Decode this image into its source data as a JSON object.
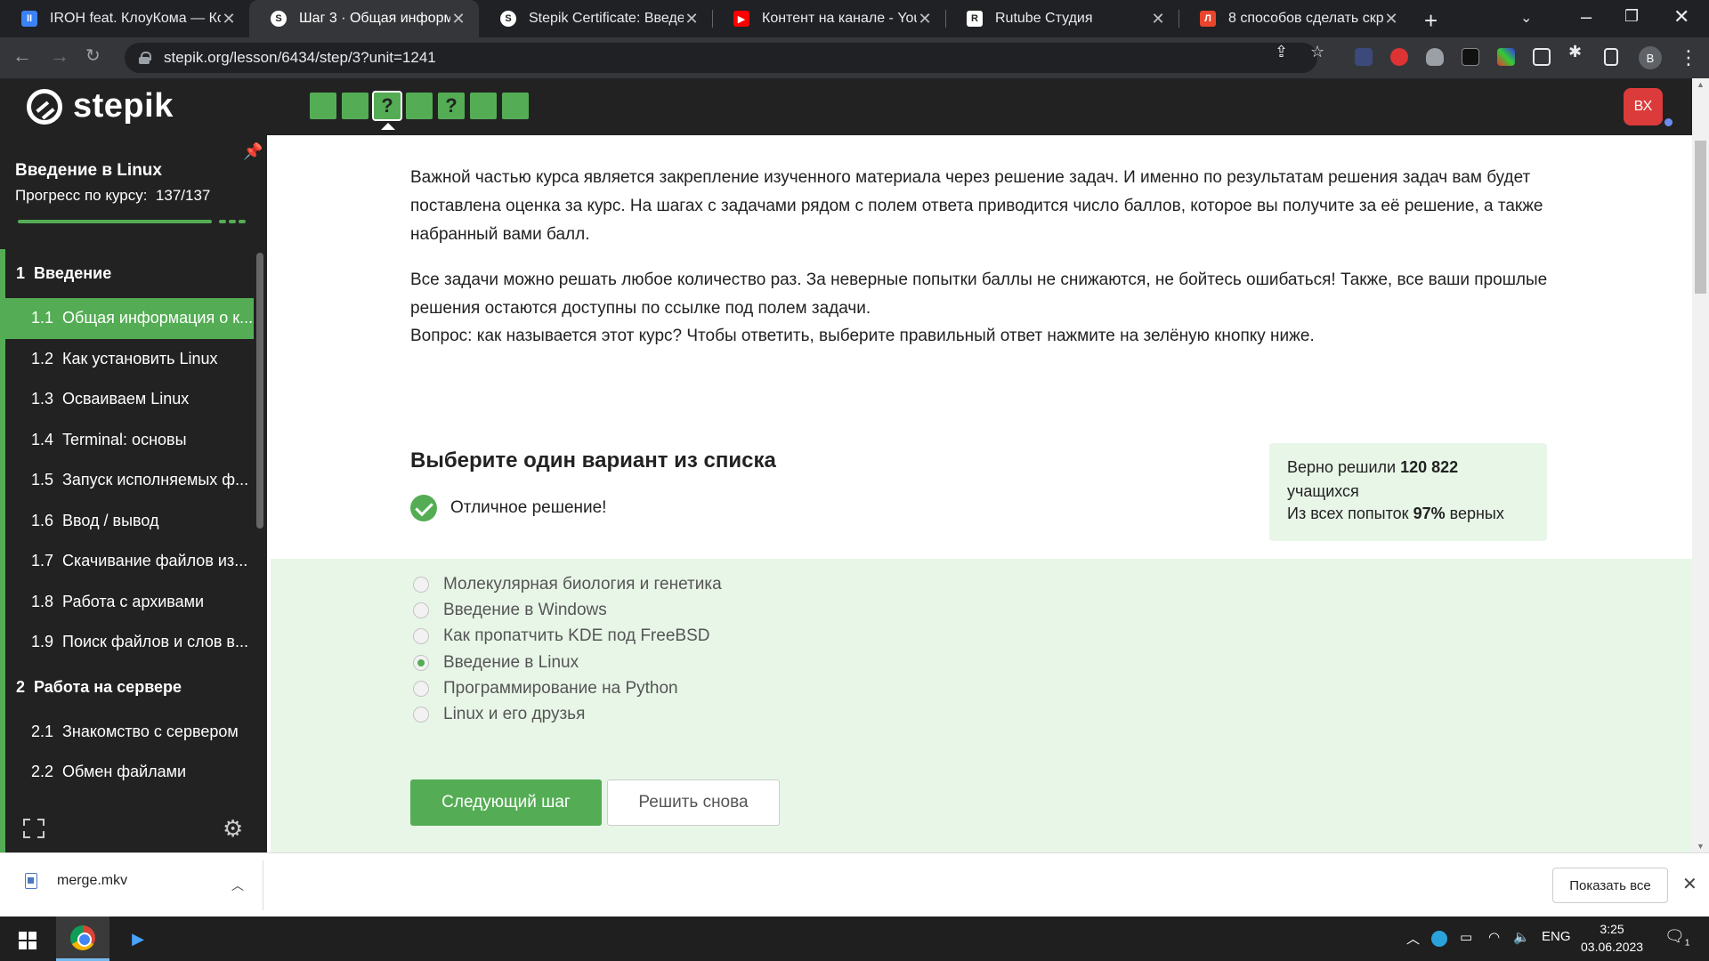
{
  "browser": {
    "tabs": [
      {
        "title": "IROH feat. КлоуКома — Ко",
        "icon": "media-icon",
        "color": "#3b82f6"
      },
      {
        "title": "Шаг 3 · Общая информаци",
        "icon": "stepik-icon",
        "color": "#ffffff",
        "active": true
      },
      {
        "title": "Stepik Certificate: Введение",
        "icon": "stepik-icon",
        "color": "#ffffff"
      },
      {
        "title": "Контент на канале - YouTu",
        "icon": "youtube-icon",
        "color": "#ff0000"
      },
      {
        "title": "Rutube Студия",
        "icon": "rutube-icon",
        "color": "#ffffff"
      },
      {
        "title": "8 способов сделать скрин",
        "icon": "lifehacker-icon",
        "color": "#e8452c"
      }
    ],
    "url": "stepik.org/lesson/6434/step/3?unit=1241",
    "profile_initial": "B"
  },
  "stepik": {
    "logo_text": "stepik",
    "steps": [
      {
        "label": "",
        "state": "done"
      },
      {
        "label": "",
        "state": "done"
      },
      {
        "label": "?",
        "state": "current"
      },
      {
        "label": "",
        "state": "done"
      },
      {
        "label": "?",
        "state": "done"
      },
      {
        "label": "",
        "state": "done"
      },
      {
        "label": "",
        "state": "done"
      }
    ],
    "user_initials": "ВХ",
    "accent_color": "#54ad54"
  },
  "sidebar": {
    "course_title": "Введение в Linux",
    "progress_label": "Прогресс по курсу:",
    "progress_value": "137/137",
    "progress_fraction": 1.0,
    "module1": {
      "num": "1",
      "title": "Введение"
    },
    "lessons1": [
      {
        "num": "1.1",
        "title": "Общая информация о к..."
      },
      {
        "num": "1.2",
        "title": "Как установить Linux"
      },
      {
        "num": "1.3",
        "title": "Осваиваем Linux"
      },
      {
        "num": "1.4",
        "title": "Terminal: основы"
      },
      {
        "num": "1.5",
        "title": "Запуск исполняемых ф..."
      },
      {
        "num": "1.6",
        "title": "Ввод / вывод"
      },
      {
        "num": "1.7",
        "title": "Скачивание файлов из..."
      },
      {
        "num": "1.8",
        "title": "Работа с архивами"
      },
      {
        "num": "1.9",
        "title": "Поиск файлов и слов в..."
      }
    ],
    "module2": {
      "num": "2",
      "title": "Работа на сервере"
    },
    "lessons2": [
      {
        "num": "2.1",
        "title": "Знакомство с сервером"
      },
      {
        "num": "2.2",
        "title": "Обмен файлами"
      }
    ]
  },
  "content": {
    "paragraph1": "Важной частью курса является закрепление изученного материала через решение задач. И именно по результатам решения задач вам будет поставлена оценка за курс. На шагах с задачами рядом с полем ответа приводится число баллов, которое вы получите за её решение, а также набранный вами балл.",
    "paragraph2": "Все задачи можно решать любое количество раз. За неверные попытки баллы не снижаются, не бойтесь ошибаться! Также, все ваши прошлые решения остаются доступны по ссылке под полем задачи.",
    "paragraph3": "Вопрос: как называется этот курс? Чтобы ответить, выберите правильный ответ нажмите на зелёную кнопку ниже.",
    "quiz_title": "Выберите один вариант из списка",
    "feedback": "Отличное решение!",
    "stats": {
      "solved_prefix": "Верно решили",
      "solved_count": "120 822",
      "solved_suffix": "учащихся",
      "attempts_prefix": "Из всех попыток",
      "attempts_percent": "97%",
      "attempts_suffix": "верных"
    },
    "options": [
      {
        "label": "Молекулярная биология и генетика",
        "checked": false
      },
      {
        "label": "Введение в Windows",
        "checked": false
      },
      {
        "label": "Как пропатчить KDE под FreeBSD",
        "checked": false
      },
      {
        "label": "Введение в Linux",
        "checked": true
      },
      {
        "label": "Программирование на Python",
        "checked": false
      },
      {
        "label": "Linux и его друзья",
        "checked": false
      }
    ],
    "next_button": "Следующий шаг",
    "retry_button": "Решить снова"
  },
  "downloads": {
    "file_name": "merge.mkv",
    "show_all": "Показать все"
  },
  "taskbar": {
    "language": "ENG",
    "time": "3:25",
    "date": "03.06.2023",
    "notification_count": "1"
  }
}
